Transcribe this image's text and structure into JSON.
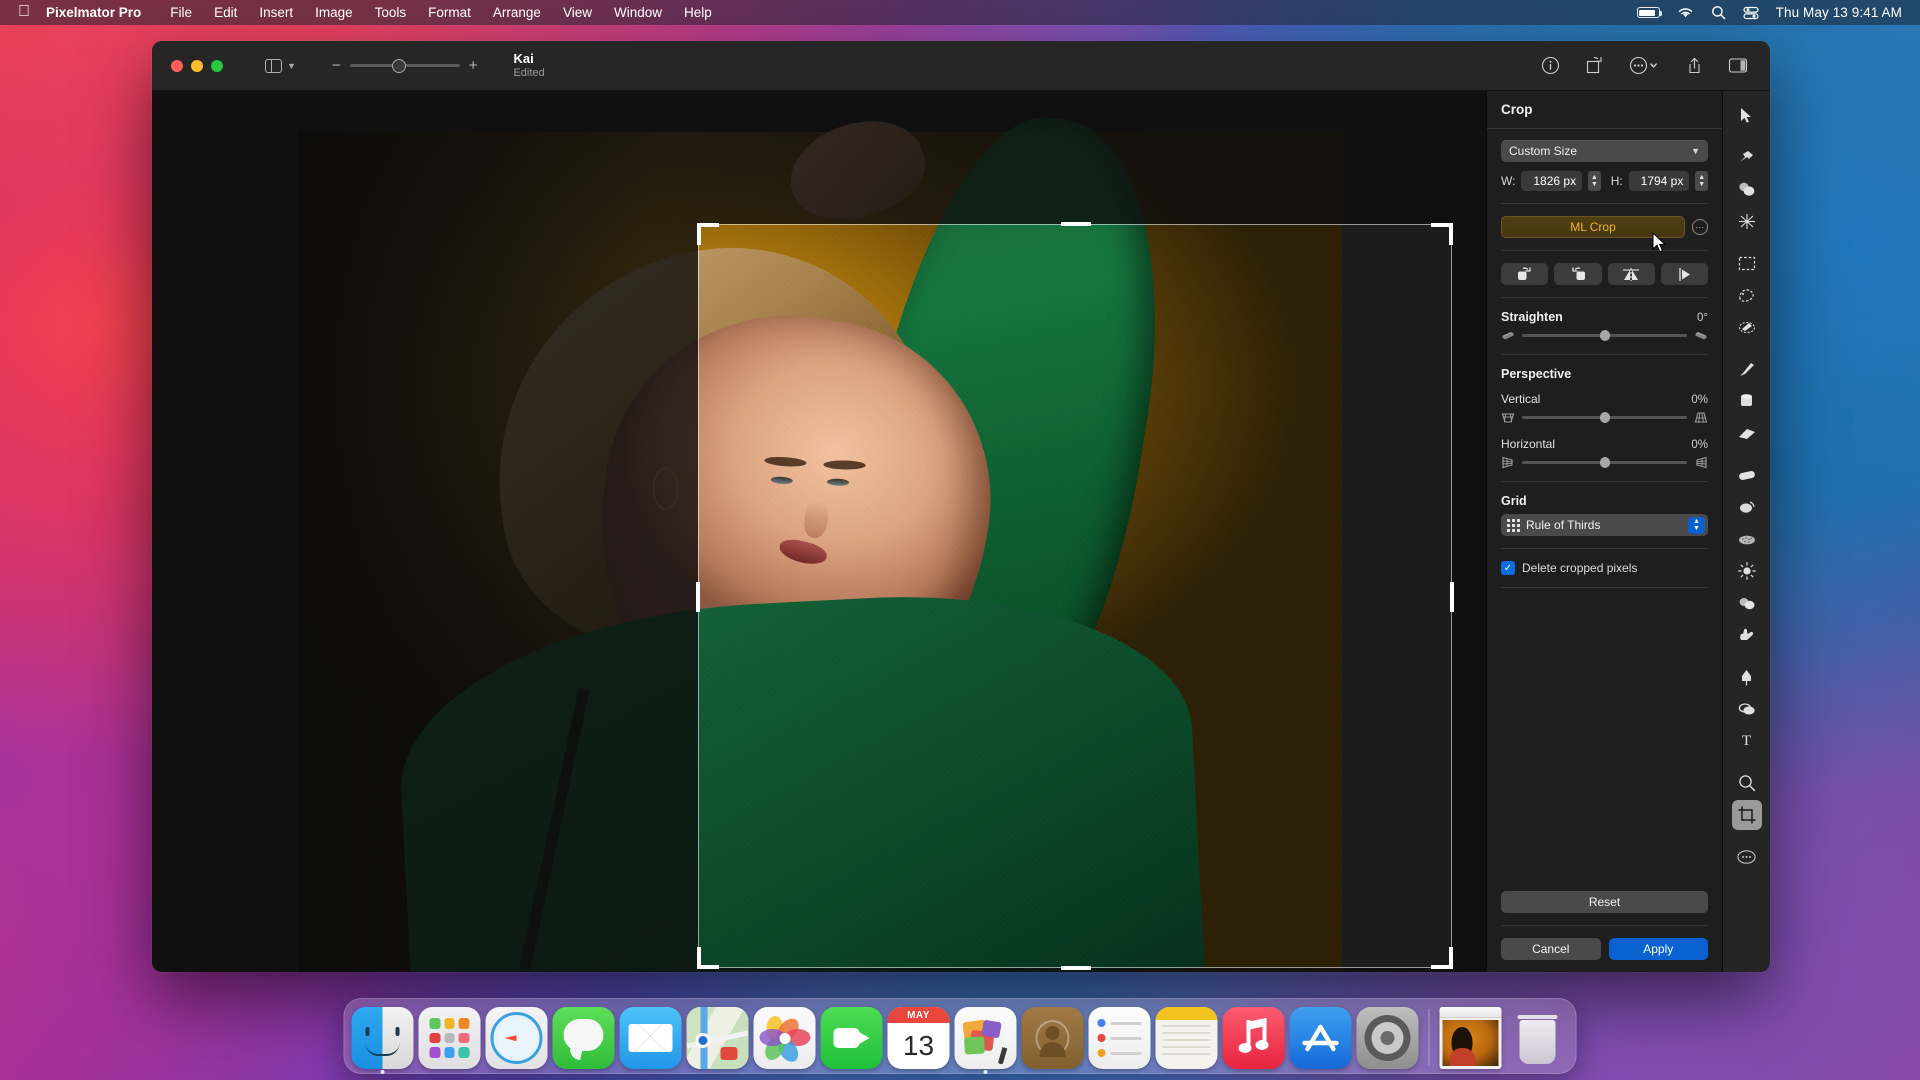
{
  "menubar": {
    "apple_icon": "apple-logo",
    "app_name": "Pixelmator Pro",
    "items": [
      "File",
      "Edit",
      "Insert",
      "Image",
      "Tools",
      "Format",
      "Arrange",
      "View",
      "Window",
      "Help"
    ],
    "status_icons": [
      "battery-icon",
      "wifi-icon",
      "search-icon",
      "control-center-icon"
    ],
    "clock": "Thu May 13  9:41 AM"
  },
  "window": {
    "title": "Kai",
    "subtitle": "Edited",
    "traffic_lights": [
      "close",
      "minimize",
      "zoom"
    ],
    "sidebar_toggle_icon": "sidebar-toggle-icon",
    "zoom_minus": "−",
    "zoom_plus": "+",
    "toolbar_right_icons": [
      "info-icon",
      "transform-icon",
      "more-options-icon",
      "share-icon",
      "right-panel-toggle-icon"
    ]
  },
  "panel": {
    "header": "Crop",
    "preset": {
      "label": "Custom Size",
      "chevron": "chevron-down-icon"
    },
    "width": {
      "label": "W:",
      "value": "1826 px"
    },
    "height": {
      "label": "H:",
      "value": "1794 px"
    },
    "ml_crop": {
      "label": "ML Crop",
      "options_icon": "ellipsis-circle-icon"
    },
    "transform_buttons": [
      {
        "name": "rotate-right",
        "glyph": "rotate-right-icon"
      },
      {
        "name": "rotate-left",
        "glyph": "rotate-left-icon"
      },
      {
        "name": "flip-vertical",
        "glyph": "flip-vertical-icon"
      },
      {
        "name": "flip-horizontal",
        "glyph": "flip-horizontal-icon"
      }
    ],
    "straighten": {
      "label": "Straighten",
      "value": "0°"
    },
    "perspective": {
      "title": "Perspective",
      "vertical": {
        "label": "Vertical",
        "value": "0%"
      },
      "horizontal": {
        "label": "Horizontal",
        "value": "0%"
      }
    },
    "grid": {
      "title": "Grid",
      "selected": "Rule of Thirds",
      "icon": "grid-icon"
    },
    "delete_cropped": {
      "label": "Delete cropped pixels",
      "checked": true
    },
    "reset": "Reset",
    "cancel": "Cancel",
    "apply": "Apply"
  },
  "tools": [
    {
      "name": "arrange-tool",
      "glyph": "➤"
    },
    {
      "name": "repair-tool",
      "glyph": "✍"
    },
    {
      "name": "clone-tool",
      "glyph": "◕"
    },
    {
      "name": "effects-tool",
      "glyph": "✷"
    },
    {
      "name": "rectangular-select-tool",
      "glyph": "▭"
    },
    {
      "name": "freeform-select-tool",
      "glyph": "❍"
    },
    {
      "name": "magic-wand-tool",
      "glyph": "✧"
    },
    {
      "name": "paint-tool",
      "glyph": "✎"
    },
    {
      "name": "paint-bucket-tool",
      "glyph": "▮"
    },
    {
      "name": "eraser-tool",
      "glyph": "▰"
    },
    {
      "name": "repair-brush-tool",
      "glyph": "▱"
    },
    {
      "name": "smudge-tool",
      "glyph": "◍"
    },
    {
      "name": "sponge-tool",
      "glyph": "▦"
    },
    {
      "name": "lighten-tool",
      "glyph": "☀"
    },
    {
      "name": "blur-tool",
      "glyph": "◕"
    },
    {
      "name": "hand-tool",
      "glyph": "✋"
    },
    {
      "name": "pen-tool",
      "glyph": "✒"
    },
    {
      "name": "shape-tool",
      "glyph": "⬭"
    },
    {
      "name": "type-tool",
      "glyph": "T"
    },
    {
      "name": "zoom-tool",
      "glyph": "⚲"
    },
    {
      "name": "crop-tool",
      "glyph": "⌗",
      "selected": true
    },
    {
      "name": "more-tools",
      "glyph": "⋯"
    }
  ],
  "dock": {
    "items": [
      {
        "name": "finder",
        "running": true
      },
      {
        "name": "launchpad",
        "running": false
      },
      {
        "name": "safari",
        "running": false
      },
      {
        "name": "messages",
        "running": false
      },
      {
        "name": "mail",
        "running": false
      },
      {
        "name": "maps",
        "running": false
      },
      {
        "name": "photos",
        "running": false
      },
      {
        "name": "facetime",
        "running": false
      },
      {
        "name": "calendar",
        "running": false,
        "month": "MAY",
        "day": "13"
      },
      {
        "name": "pixelmator-pro",
        "running": true
      },
      {
        "name": "contacts",
        "running": false
      },
      {
        "name": "reminders",
        "running": false
      },
      {
        "name": "notes",
        "running": false
      },
      {
        "name": "music",
        "running": false
      },
      {
        "name": "app-store",
        "running": false
      },
      {
        "name": "system-preferences",
        "running": false
      },
      {
        "name": "minimized-kai-window",
        "running": false
      },
      {
        "name": "trash",
        "running": false
      }
    ]
  },
  "colors": {
    "accent_blue": "#0a62d0",
    "ml_crop_amber": "#f0b429",
    "panel_bg": "#1e1e1e",
    "titlebar_bg": "#262626"
  }
}
